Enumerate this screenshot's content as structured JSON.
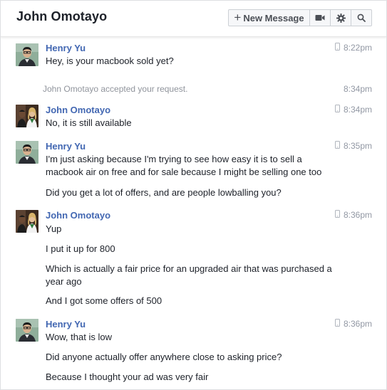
{
  "header": {
    "title": "John Omotayo",
    "new_message_label": "New Message",
    "icons": [
      "video-icon",
      "gear-icon",
      "search-icon"
    ]
  },
  "messages": [
    {
      "sender": "Henry Yu",
      "time": "8:22pm",
      "texts": [
        "Hey, is your macbook sold yet?"
      ]
    },
    {
      "system": "John Omotayo accepted your request.",
      "time": "8:34pm"
    },
    {
      "sender": "John Omotayo",
      "time": "8:34pm",
      "texts": [
        "No, it is still available"
      ]
    },
    {
      "sender": "Henry Yu",
      "time": "8:35pm",
      "texts": [
        "I'm just asking because I'm trying to see how easy it is to sell a macbook air on free and for sale because I might be selling one too",
        "Did you get a lot of offers, and are people lowballing you?"
      ]
    },
    {
      "sender": "John Omotayo",
      "time": "8:36pm",
      "texts": [
        "Yup",
        "I put it up for 800",
        "Which is actually a fair price for an upgraded air that was purchased a year ago",
        "And I got some offers of 500"
      ]
    },
    {
      "sender": "Henry Yu",
      "time": "8:36pm",
      "texts": [
        "Wow, that is low",
        "Did anyone actually offer anywhere close to asking price?",
        "Because I thought your ad was very fair"
      ]
    }
  ],
  "colors": {
    "sender_name": "#4267b2",
    "timestamp": "#9197a3",
    "text": "#1d2129"
  }
}
